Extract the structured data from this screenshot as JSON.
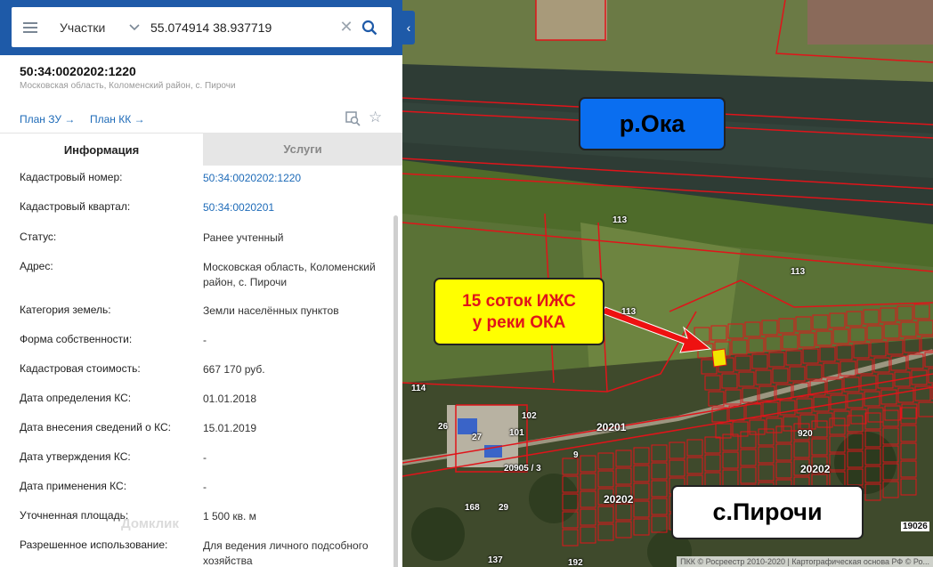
{
  "search": {
    "type_label": "Участки",
    "query": "55.074914 38.937719"
  },
  "parcel": {
    "number": "50:34:0020202:1220",
    "address": "Московская область, Коломенский район, с. Пирочи",
    "links": {
      "plan_zu": "План ЗУ →",
      "plan_kk": "План КК →"
    },
    "tabs": {
      "info": "Информация",
      "services": "Услуги"
    },
    "rows": [
      {
        "label": "Кадастровый номер:",
        "value": "50:34:0020202:1220",
        "link": true
      },
      {
        "label": "Кадастровый квартал:",
        "value": "50:34:0020201",
        "link": true
      },
      {
        "label": "Статус:",
        "value": "Ранее учтенный"
      },
      {
        "label": "Адрес:",
        "value": "Московская область, Коломенский район, с. Пирочи"
      },
      {
        "label": "Категория земель:",
        "value": "Земли населённых пунктов"
      },
      {
        "label": "Форма собственности:",
        "value": "-"
      },
      {
        "label": "Кадастровая стоимость:",
        "value": "667 170 руб."
      },
      {
        "label": "Дата определения КС:",
        "value": "01.01.2018"
      },
      {
        "label": "Дата внесения сведений о КС:",
        "value": "15.01.2019"
      },
      {
        "label": "Дата утверждения КС:",
        "value": "-"
      },
      {
        "label": "Дата применения КС:",
        "value": "-"
      },
      {
        "label": "Уточненная площадь:",
        "value": "1 500 кв. м"
      },
      {
        "label": "Разрешенное использование:",
        "value": "Для ведения личного подсобного хозяйства"
      }
    ],
    "watermark": "Домклик"
  },
  "map": {
    "callouts": {
      "river": "р.Ока",
      "plot_line1": "15 соток ИЖС",
      "plot_line2": "у реки ОКА",
      "village": "с.Пирочи"
    },
    "labels": [
      "113",
      "113",
      "113",
      "114",
      "102",
      "101",
      "26",
      "27",
      "20201",
      "920",
      "20202",
      "20202",
      "20905 / 3",
      "9",
      "168",
      "29",
      "19026",
      "192",
      "137"
    ],
    "attribution": "ПКК © Росреестр 2010-2020 | Картографическая основа РФ © Ро..."
  },
  "colors": {
    "accent": "#1e5aa8",
    "link": "#1e6bb8",
    "parcel_border": "#e0141a",
    "plot_highlight": "#f2e600",
    "river_callout": "#0a6ef0",
    "plot_callout": "#ffff00"
  }
}
